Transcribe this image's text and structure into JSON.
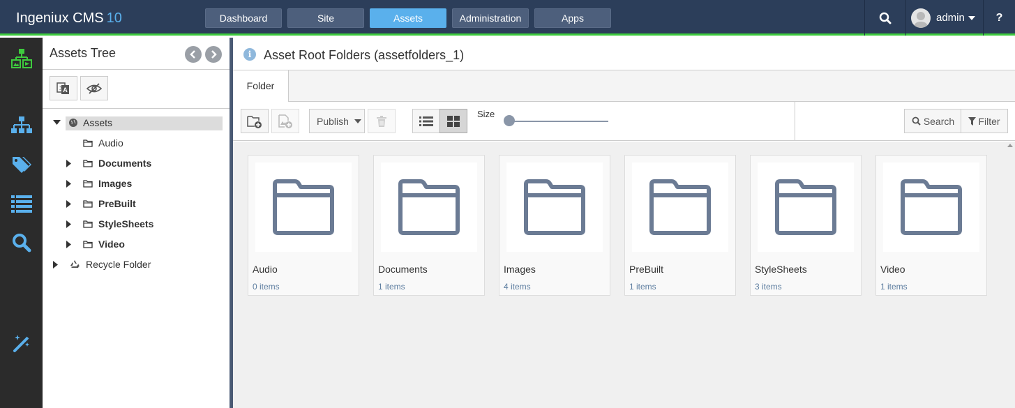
{
  "app": {
    "name": "Ingeniux CMS",
    "version": "10"
  },
  "nav": {
    "tabs": [
      {
        "label": "Dashboard",
        "active": false
      },
      {
        "label": "Site",
        "active": false
      },
      {
        "label": "Assets",
        "active": true
      },
      {
        "label": "Administration",
        "active": false
      },
      {
        "label": "Apps",
        "active": false
      }
    ],
    "user": "admin",
    "help": "?"
  },
  "rail": {
    "icons": [
      "asset-tree-icon",
      "sitemap-icon",
      "tags-icon",
      "list-icon",
      "search-icon",
      "magic-wand-icon"
    ]
  },
  "tree": {
    "title": "Assets Tree",
    "root": "Assets",
    "children": [
      {
        "label": "Audio",
        "bold": false,
        "expandable": false
      },
      {
        "label": "Documents",
        "bold": true,
        "expandable": true
      },
      {
        "label": "Images",
        "bold": true,
        "expandable": true
      },
      {
        "label": "PreBuilt",
        "bold": true,
        "expandable": true
      },
      {
        "label": "StyleSheets",
        "bold": true,
        "expandable": true
      },
      {
        "label": "Video",
        "bold": true,
        "expandable": true
      }
    ],
    "recycle": "Recycle Folder"
  },
  "main": {
    "title": "Asset Root Folders (assetfolders_1)",
    "tab": "Folder",
    "toolbar": {
      "publish": "Publish",
      "size_label": "Size",
      "search": "Search",
      "filter": "Filter"
    },
    "folders": [
      {
        "name": "Audio",
        "count": "0 items"
      },
      {
        "name": "Documents",
        "count": "1 items"
      },
      {
        "name": "Images",
        "count": "4 items"
      },
      {
        "name": "PreBuilt",
        "count": "1 items"
      },
      {
        "name": "StyleSheets",
        "count": "3 items"
      },
      {
        "name": "Video",
        "count": "1 items"
      }
    ]
  },
  "colors": {
    "topbar": "#2c3e5a",
    "accent": "#5ab0ec",
    "green_bar": "#3ecb3e",
    "rail": "#2b2b2b",
    "folder_icon": "#6b7b94"
  }
}
